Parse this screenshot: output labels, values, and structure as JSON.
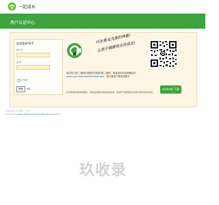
{
  "header": {
    "logo_name": "logo-icon",
    "logo_text": "一起成长",
    "banner_title": "用户认证中心",
    "brand_color": "#3ea53e"
  },
  "login": {
    "title": "欢迎登录!帮手",
    "username_label": "用户名",
    "password_label": "密 码",
    "remember_label": "记住我",
    "submit_label": "登录",
    "reset_label": "重置"
  },
  "promo": {
    "slogan_line1": "丹东黄龙沟源的神童!",
    "slogan_line2": "让孩子健康快乐的成长!",
    "description_before": "用手机上的二维码扫描软件扫描左侧二维码，或者用手机浏览器访问",
    "description_link": "www.yscc.tu/android/fhelper.apk",
    "description_after": "，即可直接下载安装帮手",
    "note": "如不能使用请联系管理员，为保证您能够获得最新的版本，请选择下载安装官方应用下载到手机中获得。",
    "android_button_label": "Android 下载"
  },
  "footer": {
    "copyright": "Copyright © 2012 - 2013",
    "powered_prefix": "Powered by",
    "powered_link": "Jasig Central Authentication Service 3.5.2"
  },
  "watermark": {
    "text": "玖收录"
  }
}
